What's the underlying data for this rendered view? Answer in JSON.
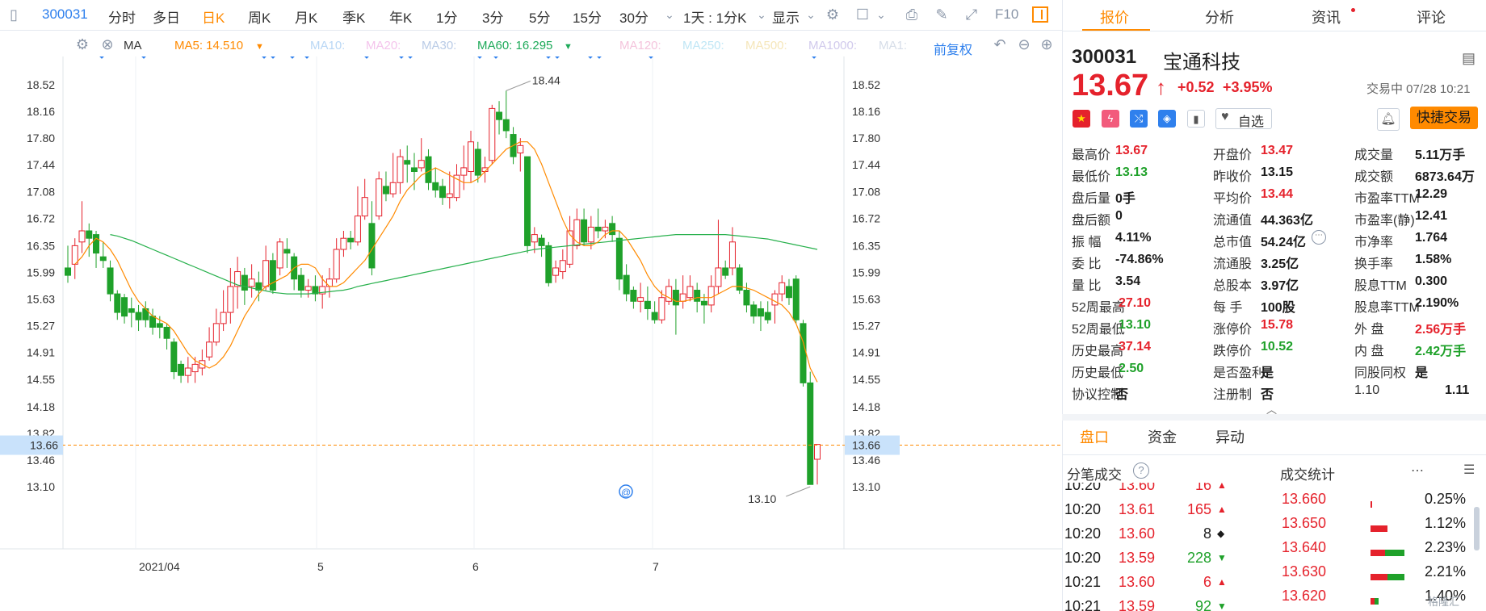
{
  "toolbar": {
    "code": "300031",
    "periods": [
      "分时",
      "多日",
      "日K",
      "周K",
      "月K",
      "季K",
      "年K",
      "1分",
      "3分",
      "5分",
      "15分",
      "30分"
    ],
    "active_period": "日K",
    "interval_label": "1天 : 1分K",
    "display_label": "显示",
    "f10_label": "F10"
  },
  "ma_bar": {
    "ma_label": "MA",
    "ma5": "MA5: 14.510",
    "ma10": "MA10:",
    "ma20": "MA20:",
    "ma30": "MA30:",
    "ma60": "MA60: 16.295",
    "ma120": "MA120:",
    "ma250": "MA250:",
    "ma500": "MA500:",
    "ma1000": "MA1000:",
    "ma1": "MA1:",
    "adjust_label": "前复权"
  },
  "chart_data": {
    "type": "candlestick",
    "y_ticks": [
      "18.52",
      "18.16",
      "17.80",
      "17.44",
      "17.08",
      "16.72",
      "16.35",
      "15.99",
      "15.63",
      "15.27",
      "14.91",
      "14.55",
      "14.18",
      "13.82",
      "13.46",
      "13.10"
    ],
    "ylim": [
      13.1,
      18.52
    ],
    "x_ticks": [
      "2021/04",
      "5",
      "6",
      "7"
    ],
    "current_price": "13.66",
    "max_label": "18.44",
    "min_label": "13.10",
    "candles": [
      [
        16.05,
        15.95,
        16.35,
        15.85
      ],
      [
        16.1,
        16.35,
        16.45,
        15.9
      ],
      [
        16.4,
        16.55,
        16.95,
        16.25
      ],
      [
        16.55,
        16.45,
        16.65,
        16.2
      ],
      [
        16.5,
        16.25,
        16.55,
        16.05
      ],
      [
        16.2,
        16.15,
        16.4,
        16.05
      ],
      [
        16.05,
        15.7,
        16.15,
        15.6
      ],
      [
        15.7,
        15.45,
        15.75,
        15.35
      ],
      [
        15.65,
        15.4,
        15.7,
        15.3
      ],
      [
        15.5,
        15.45,
        15.65,
        15.25
      ],
      [
        15.45,
        15.35,
        15.55,
        15.2
      ],
      [
        15.5,
        15.35,
        15.6,
        15.25
      ],
      [
        15.4,
        15.25,
        15.5,
        15.15
      ],
      [
        15.3,
        15.25,
        15.4,
        15.1
      ],
      [
        15.25,
        15.1,
        15.3,
        14.95
      ],
      [
        15.05,
        14.65,
        15.1,
        14.55
      ],
      [
        14.75,
        14.6,
        14.8,
        14.5
      ],
      [
        14.6,
        14.7,
        14.85,
        14.5
      ],
      [
        14.65,
        14.75,
        14.85,
        14.5
      ],
      [
        14.7,
        14.8,
        14.95,
        14.6
      ],
      [
        14.85,
        15.05,
        15.25,
        14.8
      ],
      [
        15.05,
        15.3,
        15.5,
        15.0
      ],
      [
        15.3,
        15.45,
        15.75,
        15.2
      ],
      [
        15.45,
        15.8,
        16.05,
        15.3
      ],
      [
        15.8,
        16.0,
        16.2,
        15.5
      ],
      [
        15.95,
        15.75,
        16.05,
        15.55
      ],
      [
        15.8,
        15.9,
        16.1,
        15.65
      ],
      [
        15.85,
        15.75,
        16.0,
        15.6
      ],
      [
        15.8,
        16.15,
        16.35,
        15.75
      ],
      [
        16.15,
        15.75,
        16.25,
        15.7
      ],
      [
        16.05,
        16.4,
        16.45,
        15.95
      ],
      [
        16.3,
        16.25,
        16.45,
        16.05
      ],
      [
        16.2,
        15.9,
        16.25,
        15.75
      ],
      [
        15.95,
        15.75,
        16.05,
        15.65
      ],
      [
        15.75,
        15.8,
        15.9,
        15.65
      ],
      [
        15.8,
        15.7,
        15.95,
        15.6
      ],
      [
        15.7,
        15.8,
        15.95,
        15.5
      ],
      [
        15.8,
        15.9,
        16.05,
        15.65
      ],
      [
        15.9,
        16.3,
        16.45,
        15.85
      ],
      [
        16.3,
        16.45,
        16.55,
        16.2
      ],
      [
        16.45,
        16.4,
        16.55,
        16.3
      ],
      [
        16.4,
        16.75,
        17.15,
        16.35
      ],
      [
        16.75,
        17.0,
        17.25,
        16.7
      ],
      [
        16.65,
        16.05,
        16.95,
        15.95
      ],
      [
        16.75,
        17.25,
        17.35,
        16.7
      ],
      [
        17.15,
        17.05,
        17.35,
        16.95
      ],
      [
        17.05,
        17.2,
        17.6,
        17.0
      ],
      [
        17.2,
        17.55,
        17.65,
        17.05
      ],
      [
        17.5,
        17.45,
        17.7,
        17.2
      ],
      [
        17.4,
        17.35,
        17.6,
        17.1
      ],
      [
        17.4,
        17.5,
        17.8,
        17.35
      ],
      [
        17.55,
        17.2,
        17.65,
        17.1
      ],
      [
        17.2,
        17.1,
        17.4,
        17.0
      ],
      [
        17.15,
        17.0,
        17.25,
        16.9
      ],
      [
        17.0,
        17.05,
        17.35,
        16.85
      ],
      [
        17.0,
        17.3,
        17.45,
        16.95
      ],
      [
        17.3,
        17.4,
        17.7,
        17.1
      ],
      [
        17.35,
        17.75,
        17.9,
        17.2
      ],
      [
        17.65,
        17.3,
        17.75,
        17.2
      ],
      [
        17.35,
        17.4,
        17.55,
        17.2
      ],
      [
        17.5,
        18.2,
        18.25,
        17.45
      ],
      [
        18.15,
        18.05,
        18.3,
        17.85
      ],
      [
        18.05,
        17.9,
        18.44,
        17.8
      ],
      [
        17.85,
        17.55,
        17.95,
        17.45
      ],
      [
        17.6,
        17.7,
        17.8,
        17.35
      ],
      [
        17.55,
        16.35,
        17.55,
        16.25
      ],
      [
        16.4,
        16.5,
        16.6,
        16.25
      ],
      [
        16.45,
        16.35,
        16.5,
        16.2
      ],
      [
        16.35,
        15.85,
        16.4,
        15.8
      ],
      [
        15.95,
        16.05,
        16.15,
        15.85
      ],
      [
        16.0,
        16.15,
        16.3,
        15.9
      ],
      [
        16.1,
        16.55,
        16.75,
        16.05
      ],
      [
        16.35,
        16.7,
        16.85,
        16.3
      ],
      [
        16.7,
        16.4,
        16.85,
        16.35
      ],
      [
        16.4,
        16.6,
        16.75,
        16.3
      ],
      [
        16.6,
        16.55,
        16.85,
        16.45
      ],
      [
        16.55,
        16.6,
        16.7,
        16.45
      ],
      [
        16.65,
        16.5,
        16.75,
        16.4
      ],
      [
        16.45,
        15.9,
        16.55,
        15.75
      ],
      [
        15.95,
        15.7,
        16.1,
        15.6
      ],
      [
        15.75,
        15.6,
        15.8,
        15.5
      ],
      [
        15.6,
        15.65,
        15.85,
        15.45
      ],
      [
        15.6,
        15.5,
        15.8,
        15.35
      ],
      [
        15.45,
        15.35,
        15.6,
        15.3
      ],
      [
        15.35,
        15.65,
        15.75,
        15.3
      ],
      [
        15.6,
        15.8,
        15.9,
        15.55
      ],
      [
        15.75,
        15.55,
        15.9,
        15.15
      ],
      [
        15.6,
        15.7,
        15.95,
        15.5
      ],
      [
        15.65,
        15.8,
        15.95,
        15.6
      ],
      [
        15.75,
        15.6,
        15.85,
        15.45
      ],
      [
        15.6,
        15.55,
        15.7,
        15.3
      ],
      [
        15.55,
        15.8,
        15.95,
        15.45
      ],
      [
        15.8,
        16.05,
        16.7,
        15.7
      ],
      [
        16.05,
        15.95,
        16.15,
        15.9
      ],
      [
        16.05,
        16.4,
        16.6,
        15.95
      ],
      [
        16.05,
        15.75,
        16.1,
        15.7
      ],
      [
        15.75,
        15.55,
        15.85,
        15.45
      ],
      [
        15.55,
        15.4,
        15.6,
        15.3
      ],
      [
        15.5,
        15.4,
        15.6,
        15.2
      ],
      [
        15.45,
        15.35,
        15.6,
        15.3
      ],
      [
        15.55,
        15.7,
        15.75,
        15.3
      ],
      [
        15.7,
        15.85,
        15.95,
        15.6
      ],
      [
        15.8,
        15.65,
        15.9,
        15.55
      ],
      [
        15.9,
        15.35,
        15.95,
        15.3
      ],
      [
        15.3,
        14.5,
        15.35,
        14.45
      ],
      [
        14.5,
        13.13,
        14.65,
        13.13
      ],
      [
        13.47,
        13.67,
        13.67,
        13.13
      ]
    ],
    "ma5": [
      16.1,
      16.2,
      16.35,
      16.45,
      16.4,
      16.3,
      16.15,
      15.95,
      15.75,
      15.6,
      15.5,
      15.4,
      15.35,
      15.3,
      15.2,
      15.05,
      14.9,
      14.8,
      14.75,
      14.7,
      14.75,
      14.85,
      15.0,
      15.2,
      15.4,
      15.55,
      15.7,
      15.8,
      15.85,
      15.9,
      15.95,
      16.05,
      16.1,
      16.1,
      16.05,
      15.9,
      15.8,
      15.8,
      15.85,
      15.95,
      16.05,
      16.15,
      16.3,
      16.45,
      16.6,
      16.75,
      16.95,
      17.1,
      17.2,
      17.3,
      17.35,
      17.4,
      17.35,
      17.3,
      17.25,
      17.2,
      17.2,
      17.25,
      17.35,
      17.45,
      17.55,
      17.65,
      17.7,
      17.75,
      17.75,
      17.65,
      17.45,
      17.2,
      16.95,
      16.7,
      16.5,
      16.4,
      16.35,
      16.35,
      16.4,
      16.5,
      16.55,
      16.55,
      16.45,
      16.3,
      16.15,
      15.95,
      15.8,
      15.7,
      15.65,
      15.6,
      15.6,
      15.62,
      15.65,
      15.65,
      15.65,
      15.7,
      15.75,
      15.8,
      15.8,
      15.78,
      15.75,
      15.7,
      15.65,
      15.6,
      15.55,
      15.45,
      15.3,
      15.05,
      14.7,
      14.51
    ],
    "ma60": [
      16.5,
      16.48,
      16.45,
      16.42,
      16.38,
      16.34,
      16.3,
      16.26,
      16.22,
      16.18,
      16.14,
      16.1,
      16.06,
      16.02,
      15.98,
      15.94,
      15.9,
      15.86,
      15.82,
      15.8,
      15.78,
      15.76,
      15.74,
      15.72,
      15.71,
      15.7,
      15.7,
      15.7,
      15.7,
      15.71,
      15.72,
      15.73,
      15.74,
      15.75,
      15.77,
      15.8,
      15.82,
      15.84,
      15.86,
      15.88,
      15.9,
      15.92,
      15.94,
      15.96,
      15.98,
      16.0,
      16.02,
      16.04,
      16.06,
      16.08,
      16.1,
      16.12,
      16.14,
      16.16,
      16.18,
      16.2,
      16.22,
      16.24,
      16.26,
      16.28,
      16.3,
      16.31,
      16.32,
      16.33,
      16.34,
      16.35,
      16.36,
      16.37,
      16.38,
      16.39,
      16.4,
      16.41,
      16.42,
      16.43,
      16.44,
      16.45,
      16.46,
      16.47,
      16.48,
      16.49,
      16.5,
      16.5,
      16.5,
      16.5,
      16.5,
      16.5,
      16.5,
      16.5,
      16.49,
      16.48,
      16.47,
      16.46,
      16.45,
      16.44,
      16.42,
      16.4,
      16.38,
      16.36,
      16.34,
      16.32,
      16.3
    ]
  },
  "quote": {
    "tabs": [
      "报价",
      "分析",
      "资讯",
      "评论"
    ],
    "code": "300031",
    "name": "宝通科技",
    "price": "13.67",
    "arrow": "↑",
    "change": "+0.52",
    "change_pct": "+3.95%",
    "status": "交易中 07/28 10:21",
    "watch_label": "自选",
    "quick_trade_label": "快捷交易",
    "fields": [
      [
        "最高价",
        "13.67",
        "red",
        "开盘价",
        "13.47",
        "red",
        "成交量",
        "5.11万手",
        "dark"
      ],
      [
        "最低价",
        "13.13",
        "green",
        "昨收价",
        "13.15",
        "dark",
        "成交额",
        "6873.64万",
        "dark"
      ],
      [
        "盘后量",
        "0手",
        "dark",
        "平均价",
        "13.44",
        "red",
        "市盈率TTM",
        "12.29",
        "dark"
      ],
      [
        "盘后额",
        "0",
        "dark",
        "流通值",
        "44.363亿",
        "dark",
        "市盈率(静)",
        "12.41",
        "dark"
      ],
      [
        "振 幅",
        "4.11%",
        "dark",
        "总市值",
        "54.24亿",
        "dark",
        "市净率",
        "1.764",
        "dark"
      ],
      [
        "委 比",
        "-74.86%",
        "dark",
        "流通股",
        "3.25亿",
        "dark",
        "换手率",
        "1.58%",
        "dark"
      ],
      [
        "量 比",
        "3.54",
        "dark",
        "总股本",
        "3.97亿",
        "dark",
        "股息TTM",
        "0.300",
        "dark"
      ],
      [
        "52周最高",
        "27.10",
        "red",
        "每 手",
        "100股",
        "dark",
        "股息率TTM",
        "2.190%",
        "dark"
      ],
      [
        "52周最低",
        "13.10",
        "green",
        "涨停价",
        "15.78",
        "red",
        "外 盘",
        "2.56万手",
        "red"
      ],
      [
        "历史最高",
        "37.14",
        "red",
        "跌停价",
        "10.52",
        "green",
        "内 盘",
        "2.42万手",
        "green"
      ],
      [
        "历史最低",
        "2.50",
        "green",
        "是否盈利",
        "是",
        "dark",
        "同股同权",
        "是",
        "dark"
      ],
      [
        "协议控制",
        "否",
        "dark",
        "注册制",
        "否",
        "dark",
        "1.10",
        "1.11",
        "dark"
      ]
    ]
  },
  "bottom": {
    "tabs": [
      "盘口",
      "资金",
      "异动"
    ],
    "ticks_title": "分笔成交",
    "stats_title": "成交统计",
    "ticks": [
      [
        "10:20",
        "13.60",
        "16",
        "up"
      ],
      [
        "10:20",
        "13.61",
        "165",
        "up"
      ],
      [
        "10:20",
        "13.60",
        "8",
        "flat"
      ],
      [
        "10:20",
        "13.59",
        "228",
        "down"
      ],
      [
        "10:21",
        "13.60",
        "6",
        "up"
      ],
      [
        "10:21",
        "13.59",
        "92",
        "down"
      ]
    ],
    "stats": [
      [
        "13.660",
        "0.25%",
        0.04,
        0.0
      ],
      [
        "13.650",
        "1.12%",
        0.35,
        0.0
      ],
      [
        "13.640",
        "2.23%",
        0.3,
        0.4
      ],
      [
        "13.630",
        "2.21%",
        0.35,
        0.35
      ],
      [
        "13.620",
        "1.40%",
        0.08,
        0.08
      ]
    ],
    "watermark": "格隆汇"
  },
  "colors": {
    "up": "#e5222c",
    "down": "#1fa12a",
    "accent": "#ff8a00",
    "blue": "#2f80ed"
  }
}
